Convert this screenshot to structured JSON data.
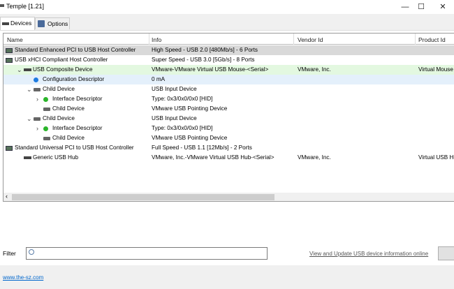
{
  "window": {
    "title": "Temple [1.21]",
    "minimize": "—",
    "maximize": "☐",
    "close": "✕"
  },
  "tabs": [
    {
      "label": "Devices"
    },
    {
      "label": "Options"
    }
  ],
  "columns": [
    "Name",
    "Info",
    "Vendor Id",
    "Product Id"
  ],
  "rows": [
    {
      "name": "Standard Enhanced PCI to USB Host Controller",
      "info": "High Speed - USB 2.0 [480Mb/s] - 6 Ports",
      "vendor": "",
      "product": "",
      "level": 0,
      "icon": "pci-controller-icon",
      "style": "sel"
    },
    {
      "name": "USB xHCI Compliant Host Controller",
      "info": "Super Speed - USB 3.0 [5Gb/s] - 8 Ports",
      "vendor": "",
      "product": "",
      "level": 0,
      "icon": "pci-controller-icon",
      "style": ""
    },
    {
      "name": "USB Composite Device",
      "info": "VMware-VMware Virtual USB Mouse-<Serial>",
      "vendor": "VMware, Inc.",
      "product": "Virtual Mouse",
      "level": 1,
      "icon": "usb-plug-icon",
      "style": "green",
      "chevron": "down"
    },
    {
      "name": "Configuration Descriptor",
      "info": "0 mA",
      "vendor": "",
      "product": "",
      "level": 2,
      "icon": "blue-dot-icon",
      "style": "blue"
    },
    {
      "name": "Child Device",
      "info": "USB Input Device",
      "vendor": "",
      "product": "",
      "level": 2,
      "icon": "keyboard-icon",
      "style": "",
      "chevron": "down"
    },
    {
      "name": "Interface Descriptor",
      "info": "Type: 0x3/0x0/0x0 [HID]",
      "vendor": "",
      "product": "",
      "level": 3,
      "icon": "green-dot-icon",
      "style": "",
      "chevron": "right"
    },
    {
      "name": "Child Device",
      "info": "VMware USB Pointing Device",
      "vendor": "",
      "product": "",
      "level": 3,
      "icon": "keyboard-icon",
      "style": ""
    },
    {
      "name": "Child Device",
      "info": "USB Input Device",
      "vendor": "",
      "product": "",
      "level": 2,
      "icon": "keyboard-icon",
      "style": "",
      "chevron": "down"
    },
    {
      "name": "Interface Descriptor",
      "info": "Type: 0x3/0x0/0x0 [HID]",
      "vendor": "",
      "product": "",
      "level": 3,
      "icon": "green-dot-icon",
      "style": "",
      "chevron": "right"
    },
    {
      "name": "Child Device",
      "info": "VMware USB Pointing Device",
      "vendor": "",
      "product": "",
      "level": 3,
      "icon": "keyboard-icon",
      "style": ""
    },
    {
      "name": "Standard Universal PCI to USB Host Controller",
      "info": "Full Speed - USB 1.1 [12Mb/s] - 2 Ports",
      "vendor": "",
      "product": "",
      "level": 0,
      "icon": "pci-controller-icon",
      "style": ""
    },
    {
      "name": "Generic USB Hub",
      "info": "VMware, Inc.-VMware Virtual USB Hub-<Serial>",
      "vendor": "VMware, Inc.",
      "product": "Virtual USB Hu",
      "level": 1,
      "icon": "hub-icon",
      "style": ""
    }
  ],
  "filter": {
    "label": "Filter",
    "value": ""
  },
  "online_link": "View and Update USB device information online",
  "footer_link": "www.the-sz.com",
  "colors": {
    "link": "#0066cc",
    "selected": "#d9d9d9",
    "green_row": "#e3f8e0",
    "blue_row": "#e4f0fb"
  }
}
